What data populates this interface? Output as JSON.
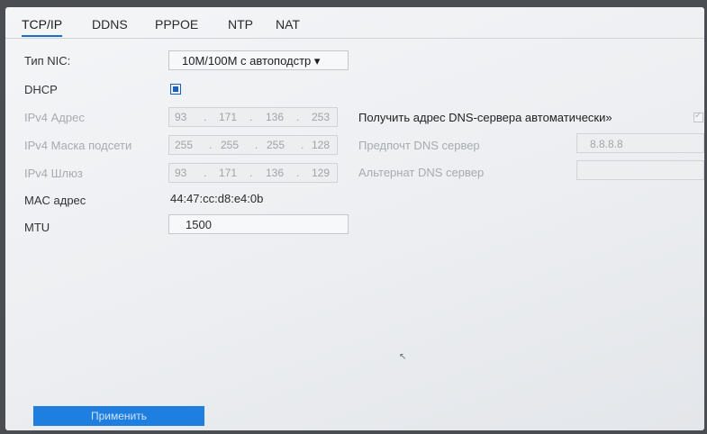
{
  "tabs": [
    {
      "label": "TCP/IP",
      "active": true
    },
    {
      "label": "DDNS"
    },
    {
      "label": "PPPOE"
    },
    {
      "label": "NTP"
    },
    {
      "label": "NAT"
    }
  ],
  "fields": {
    "nic_type": {
      "label": "Тип NIC:",
      "value": "10M/100M с автоподстр ▾"
    },
    "dhcp": {
      "label": "DHCP",
      "checked": true
    },
    "ipv4_address": {
      "label": "IPv4 Адрес",
      "octets": [
        "93",
        "171",
        "136",
        "253"
      ]
    },
    "ipv4_mask": {
      "label": "IPv4 Маска подсети",
      "octets": [
        "255",
        "255",
        "255",
        "128"
      ]
    },
    "ipv4_gateway": {
      "label": "IPv4 Шлюз",
      "octets": [
        "93",
        "171",
        "136",
        "129"
      ]
    },
    "mac": {
      "label": "MAC адрес",
      "value": "44:47:cc:d8:e4:0b"
    },
    "mtu": {
      "label": "MTU",
      "value": "1500"
    }
  },
  "dns": {
    "auto_label": "Получить адрес DNS-сервера автоматически»",
    "auto_checked": true,
    "preferred_label": "Предпочт DNS сервер",
    "preferred_value": "8.8.8.8",
    "alternate_label": "Альтернат DNS сервер",
    "alternate_value": ""
  },
  "apply_label": "Применить"
}
